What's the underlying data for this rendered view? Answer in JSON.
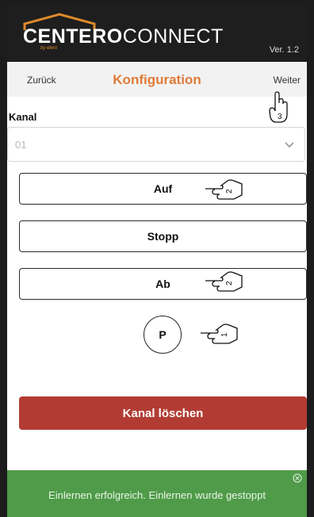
{
  "header": {
    "logo_bold": "CENTERO",
    "logo_light": "CONNECT",
    "logo_sub": "by elero",
    "version": "Ver. 1.2"
  },
  "nav": {
    "back_label": "Zurück",
    "title": "Konfiguration",
    "next_label": "Weiter"
  },
  "channel": {
    "label": "Kanal",
    "selected": "01"
  },
  "commands": {
    "up_label": "Auf",
    "stop_label": "Stopp",
    "down_label": "Ab",
    "program_label": "P"
  },
  "gesture_hints": {
    "next_step": "3",
    "up_step": "2",
    "down_step": "2",
    "program_step": "1"
  },
  "delete_label": "Kanal löschen",
  "toast": {
    "message": "Einlernen erfolgreich. Einlernen wurde gestoppt"
  },
  "colors": {
    "accent_orange": "#e07b39",
    "delete_red": "#b23c33",
    "success_green": "#4f9b49"
  }
}
